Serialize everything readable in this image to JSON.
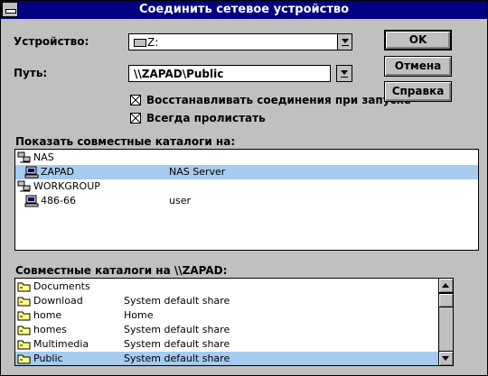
{
  "window": {
    "title": "Соединить сетевое устройство"
  },
  "device": {
    "label": "Устройство:",
    "value": "Z:"
  },
  "path": {
    "label": "Путь:",
    "value": "\\\\ZAPAD\\Public"
  },
  "buttons": {
    "ok": "OK",
    "cancel": "Отмена",
    "help": "Справка"
  },
  "options": {
    "reconnect": {
      "label": "Восстанавливать соединения при запуске",
      "checked": true
    },
    "always_browse": {
      "label": "Всегда пролистать",
      "checked": true
    }
  },
  "shared_dirs": {
    "label": "Показать совместные каталоги на:",
    "items": [
      {
        "name": "NAS",
        "comment": "",
        "icon": "workgroup-icon",
        "indent": 0,
        "selected": false
      },
      {
        "name": "ZAPAD",
        "comment": "NAS Server",
        "icon": "computer-icon",
        "indent": 1,
        "selected": true
      },
      {
        "name": "WORKGROUP",
        "comment": "",
        "icon": "workgroup-icon",
        "indent": 0,
        "selected": false
      },
      {
        "name": "486-66",
        "comment": "user",
        "icon": "computer-icon",
        "indent": 1,
        "selected": false
      }
    ]
  },
  "shares": {
    "label": "Совместные каталоги на \\\\ZAPAD:",
    "items": [
      {
        "name": "Documents",
        "comment": "",
        "selected": false
      },
      {
        "name": "Download",
        "comment": "System default share",
        "selected": false
      },
      {
        "name": "home",
        "comment": "Home",
        "selected": false
      },
      {
        "name": "homes",
        "comment": "System default share",
        "selected": false
      },
      {
        "name": "Multimedia",
        "comment": "System default share",
        "selected": false
      },
      {
        "name": "Public",
        "comment": "System default share",
        "selected": true
      }
    ]
  },
  "colors": {
    "title_bar": "#000080",
    "face": "#c0c0c0",
    "selection": "#a6caf0"
  }
}
